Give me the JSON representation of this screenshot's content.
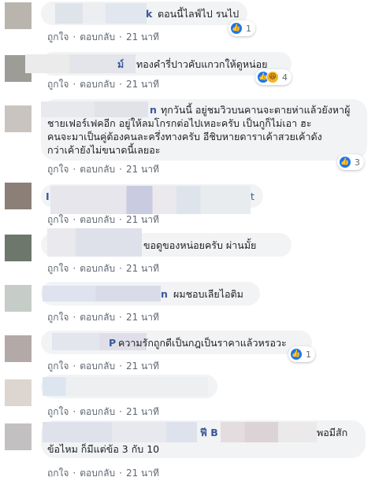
{
  "action_labels": {
    "like": "ถูกใจ",
    "reply": "ตอบกลับ",
    "sep": "·",
    "time": "21 นาที"
  },
  "comments": [
    {
      "name_suffix": "k",
      "text": "ตอนนี้ไลฟ์ไป รนไป",
      "reaction_count": "1",
      "reactions": [
        "like-icon"
      ]
    },
    {
      "name_suffix": "ม์",
      "text": "ทองคำรี่ปาวคับแกวกให้ดูหน่อย",
      "reaction_count": "4",
      "reactions": [
        "like-icon",
        "haha-icon"
      ]
    },
    {
      "name_suffix": "n",
      "text_lines": [
        "ทุกวันนี้ อยู่ชมวิวบนคานจะตายห่าแล้วยังหาผู้",
        "ชายเฟอร์เฟคอีก อยู่ให้ลมโกรกต่อไปเหอะครับ เป็นกูก็ไม่เอา ฮะ",
        "คนจะมาเป็นคู่ต้องคนละครึ่งทางครับ อีชิบหายดาราเค้าสวยเค้าดัง",
        "กว่าเค้ายังไม่ขนาดนี้เลยอะ"
      ],
      "reaction_count": "3",
      "reactions": [
        "like-icon"
      ]
    },
    {
      "name_prefix": "I",
      "name_suffix": "t"
    },
    {
      "text": "ขอดูของหน่อยครับ ผ่านมั้ย"
    },
    {
      "name_suffix": "n",
      "text": "ผมชอบเลียไอติม"
    },
    {
      "name_suffix": "P",
      "text": "ความรักถูกดีเป็นกฎเป็นราคาแล้วหรอวะ",
      "reaction_count": "1",
      "reactions": [
        "like-icon"
      ]
    },
    {},
    {
      "name_suffix": "ฟี B",
      "text_right": "พอมีสัก",
      "text_line2": "ข้อไหม  ก็มีแต่ข้อ 3 กับ 10"
    }
  ],
  "colors": {
    "like": "#1877f2",
    "haha": "#f7b125",
    "bubble": "#f2f3f5",
    "meta": "#606770"
  }
}
